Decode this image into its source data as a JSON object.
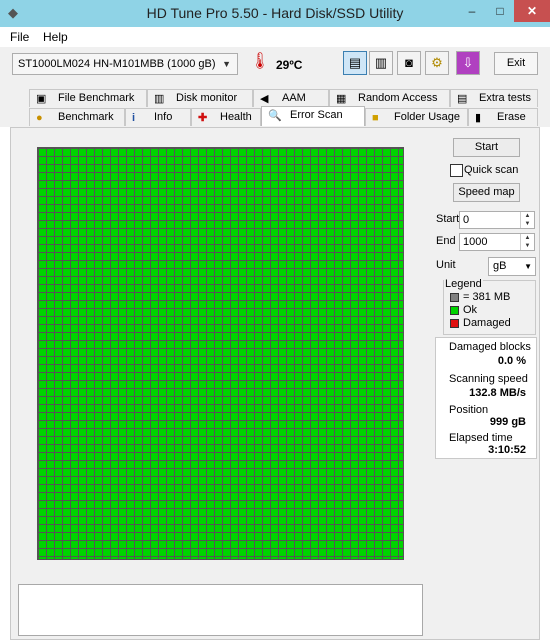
{
  "window": {
    "title": "HD Tune Pro 5.50 - Hard Disk/SSD Utility",
    "minimize": "–",
    "maximize": "□",
    "close": "✕"
  },
  "menu": {
    "file": "File",
    "help": "Help"
  },
  "toolbar": {
    "drive": "ST1000LM024 HN-M101MBB (1000 gB)",
    "temperature": "29ºC",
    "exit": "Exit"
  },
  "tabs_top": [
    "File Benchmark",
    "Disk monitor",
    "AAM",
    "Random Access",
    "Extra tests"
  ],
  "tabs_bottom": [
    "Benchmark",
    "Info",
    "Health",
    "Error Scan",
    "Folder Usage",
    "Erase"
  ],
  "scan": {
    "start_button": "Start",
    "quick_scan": "Quick scan",
    "speed_map": "Speed map",
    "start_label": "Start",
    "start_value": "0",
    "end_label": "End",
    "end_value": "1000",
    "unit_label": "Unit",
    "unit_value": "gB"
  },
  "legend": {
    "title": "Legend",
    "block": "= 381 MB",
    "ok": "Ok",
    "damaged": "Damaged",
    "colors": {
      "block": "#808080",
      "ok": "#00d400",
      "damaged": "#e01010"
    }
  },
  "stats": {
    "damaged_label": "Damaged blocks",
    "damaged_value": "0.0 %",
    "speed_label": "Scanning speed",
    "speed_value": "132.8 MB/s",
    "position_label": "Position",
    "position_value": "999 gB",
    "elapsed_label": "Elapsed time",
    "elapsed_value": "3:10:52"
  },
  "scan_progress": 1.0
}
